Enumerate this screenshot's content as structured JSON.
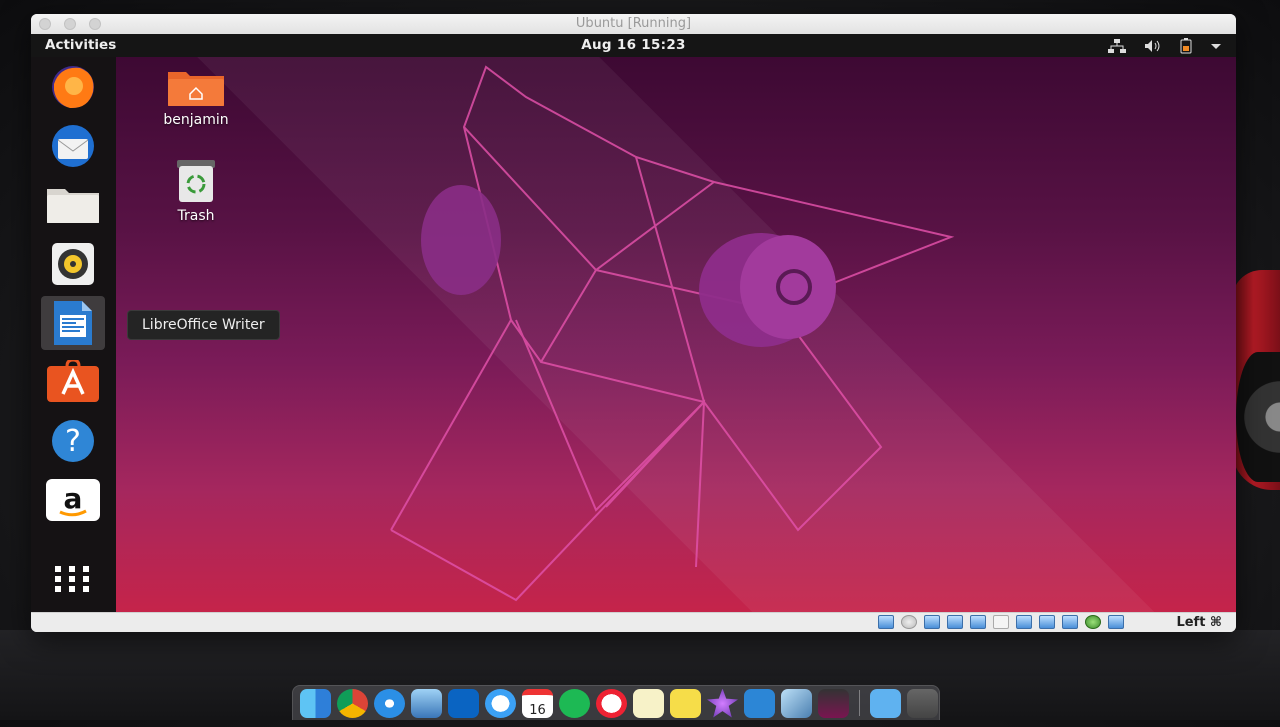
{
  "vm_window": {
    "title": "Ubuntu [Running]"
  },
  "topbar": {
    "activities": "Activities",
    "datetime": "Aug 16  15:23",
    "tray_icons": [
      "network-icon",
      "volume-icon",
      "battery-icon",
      "system-menu-arrow-icon"
    ]
  },
  "dock": {
    "items": [
      {
        "name": "firefox",
        "icon": "firefox-icon"
      },
      {
        "name": "thunderbird",
        "icon": "thunderbird-icon"
      },
      {
        "name": "files",
        "icon": "files-icon"
      },
      {
        "name": "rhythmbox",
        "icon": "rhythmbox-icon"
      },
      {
        "name": "libreoffice-writer",
        "icon": "writer-icon",
        "active": true
      },
      {
        "name": "ubuntu-software",
        "icon": "software-icon"
      },
      {
        "name": "help",
        "icon": "help-icon"
      },
      {
        "name": "amazon",
        "icon": "amazon-icon"
      }
    ],
    "show_apps_icon": "app-grid-icon"
  },
  "tooltip": {
    "text": "LibreOffice Writer"
  },
  "desktop": {
    "home_label": "benjamin",
    "trash_label": "Trash"
  },
  "vm_statusbar": {
    "host_key": "Left ⌘"
  },
  "mac_dock": {
    "apps": [
      "finder",
      "chrome",
      "safari",
      "preview",
      "outlook",
      "messages",
      "calendar",
      "spotify",
      "blocker",
      "notes",
      "stickies",
      "imovie",
      "pse",
      "virtualbox",
      "screen",
      "downloads-folder",
      "trash"
    ],
    "calendar_day": "16"
  },
  "colors": {
    "accent_orange": "#e95420",
    "aubergine": "#2c001e",
    "topbar": "#151515"
  }
}
